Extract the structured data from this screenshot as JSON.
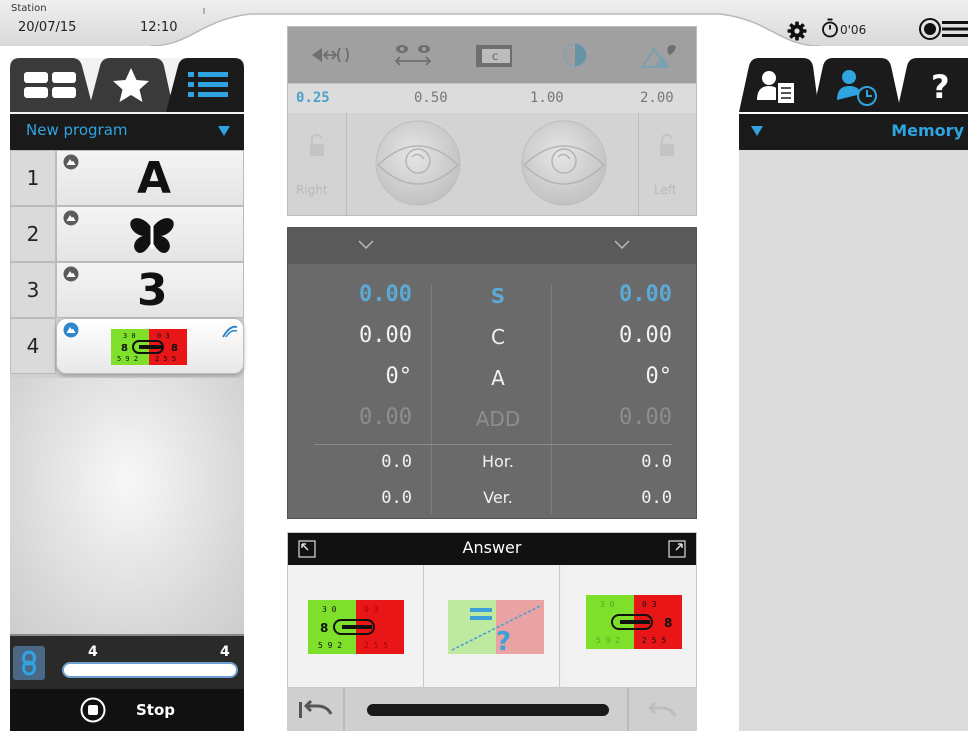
{
  "header": {
    "station_label": "Station",
    "date": "20/07/15",
    "time": "12:10",
    "timer": "0'06"
  },
  "left_panel": {
    "tabs": [
      {
        "icon": "grid-icon"
      },
      {
        "icon": "star-icon"
      },
      {
        "icon": "list-icon",
        "active": true
      }
    ],
    "program_name": "New program",
    "program_rows": [
      {
        "number": "1",
        "target": "A"
      },
      {
        "number": "2",
        "target": "butterfly-icon"
      },
      {
        "number": "3",
        "target": "3"
      },
      {
        "number": "4",
        "target": "duochrome-chart",
        "selected": true
      }
    ],
    "progress": {
      "current": "4",
      "total": "4",
      "fraction": 1.0
    },
    "stop_label": "Stop"
  },
  "lens_panel": {
    "icons": [
      "prism-icon",
      "binocular-icon",
      "chart-icon",
      "cross-cylinder-icon",
      "fog-icon"
    ],
    "steps": [
      "0.25",
      "0.50",
      "1.00",
      "2.00"
    ],
    "active_step": "0.25",
    "right_label": "Right",
    "left_label": "Left"
  },
  "refraction": {
    "rows": [
      {
        "key": "S",
        "right": "0.00",
        "left": "0.00",
        "state": "active"
      },
      {
        "key": "C",
        "right": "0.00",
        "left": "0.00",
        "state": "normal"
      },
      {
        "key": "A",
        "right": "0°",
        "left": "0°",
        "state": "normal"
      },
      {
        "key": "ADD",
        "right": "0.00",
        "left": "0.00",
        "state": "dim"
      },
      {
        "key": "Hor.",
        "right": "0.0",
        "left": "0.0",
        "state": "small"
      },
      {
        "key": "Ver.",
        "right": "0.0",
        "left": "0.0",
        "state": "small"
      }
    ]
  },
  "answer": {
    "title": "Answer",
    "options": [
      "green-side-clearer",
      "unsure",
      "red-side-clearer"
    ]
  },
  "right_panel": {
    "tabs": [
      {
        "icon": "patient-record-icon"
      },
      {
        "icon": "patient-history-icon",
        "active": true
      },
      {
        "icon": "help-icon",
        "label": "?"
      }
    ],
    "memory_label": "Memory"
  },
  "colors": {
    "accent": "#2fa4e0",
    "active_value": "#5aa9d6",
    "duochrome_green": "#7ee02a",
    "duochrome_red": "#e81616"
  }
}
